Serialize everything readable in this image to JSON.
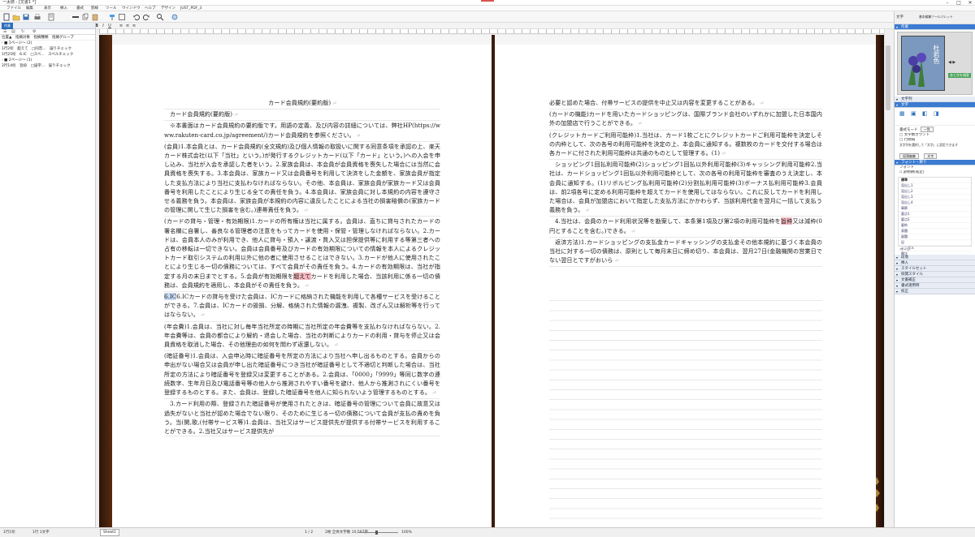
{
  "window": {
    "title": "一太郎 - [文書1 *]",
    "min": "–",
    "max": "□",
    "close": "✕"
  },
  "menu": [
    "ファイル",
    "編集",
    "表示",
    "挿入",
    "書式",
    "罫線",
    "ツール",
    "ウインドウ",
    "ヘルプ",
    "デザイン",
    "JUST_PDF_3"
  ],
  "toolbar": {
    "font_name": "(和欧混在)",
    "font_size": "10.5",
    "right_label": "文字"
  },
  "left_panel": {
    "tab_label": "作業",
    "columns": "位置▲　指摘対象　指摘種類　指摘グループ",
    "rows": [
      "- ■ 1ページ～ (2)",
      "1行2桁　超えて　□同音...　誤りチェック",
      "1行25桁　6.IC　□スペ...　スペルチェック",
      "- ■ 2ページ～ (1)",
      "2行14桁　旨枠　□誤字...　誤りチェック"
    ]
  },
  "doc": {
    "left_page": {
      "title": "カード会員規約(要約版)",
      "subtitle": "カード会員規約(要約版)",
      "paras": [
        "※本書面はカード会員規約の要約版です。用語の定義、及び内容の詳細については、弊社HP(https://www.rakuten-card.co.jp/agreement/)カード会員規約を参照ください。",
        "(会員)1.本会員とは、カード会員規約(全文規約)及び個人情報の取扱いに関する同意条項を承認の上、楽天カード株式会社(以下「当社」という。)が発行するクレジットカード(以下「カード」という。)への入会を申し込み、当社が入会を承認した者をいう。2.家族会員は、本会員が会員資格を喪失した場合には当然に会員資格を喪失する。3.本会員は、家族カード又は会員番号を利用して決済をした金額を、家族会員が指定した支払方法により当社に支払わなければならない。その他、本会員は、家族会員が家族カード又は会員番号を利用したことにより生じる全ての責任を負う。4.本会員は、家族会員に対し本規約の内容を遵守させる義務を負う。本会員は、家族会員が本規約の内容に違反したことによる当社の損害賠償の(家族カードの管理に関して生じた損害を含む。)連帯責任を負う。",
        "(カードの貸与・管理・有効期限)1.カードの所有権は当社に属する。会員は、直ちに貸与されたカードの署名欄に自署し、善良なる管理者の注意をもってカードを使用・保管・管理しなければならない。2.カードは、会員本人のみが利用でき、他人に貸与・預入・譲渡・質入又は担保提供等に利用する等第三者への占有の移転は一切できない。会員は会員番号及びカードの有効期限についての情報を本人によるクレジットカード取引システムの利用以外に他の者に使用させることはできない。3.カードが他人に使用されたことにより生じる一切の債務については、すべて会員がその責任を負う。4.カードの有効期限は、当社が指定する月の末日までとする。5.会員が有効期限を",
        "6.ICカードの貸与を受けた会員は、ICカードに格納された機能を利用して各種サービスを受けることができる。7.会員は、ICカードの毀損、分解、格納された情報の漏洩、複製、改ざん又は解析等を行ってはならない。",
        "(年会費)1.会員は、当社に対し毎年当社所定の時期に当社所定の年会費等を支払わなければならない。2.年会費等は、会員の都合により解約・退会した場合、当社の判断によりカードの利用・貸与を停止又は会員資格を取消した場合、その他理由の如何を問わず返還しない。",
        "(暗証番号)1.会員は、入会申込時に暗証番号を所定の方法により当社へ申し出るものとする。会員からの申出がない場合又は会員が申し出た暗証番号につき当社が暗証番号として不適切と判断した場合は、当社所定の方法により暗証番号を登録又は変更することがある。2.会員は、「0000」「9999」等同じ数字の連続数字、生年月日及び電話番号等の他人から推測されやすい番号を避け、他人から推測されにくい番号を登録するものとする。また、会員は、登録した暗証番号を他人に知られないよう管理するものとする。",
        "3.カード利用の際、登録された暗証番号が使用されたときは、暗証番号の管理について会員に故意又は過失がないと当社が認めた場合でない限り、そのために生じる一切の債務について会員が支払の責めを負う。当(関,歌,(付帯サービス等)1.会員は、当社又はサービス提供先が提供する付帯サービスを利用することができる。2.当社又はサービス提供先が"
      ],
      "hl_before": "5.会員が有効期限を",
      "hl_red": "超えて",
      "hl_after": "カードを利用した場合、当該利用に係る一切の債務は、会員規約を適用し、本会員がその責任を負う。",
      "hl_blue": "6.IC"
    },
    "right_page": {
      "paras": [
        "必要と認めた場合、付帯サービスの提供を中止又は内容を変更することがある。",
        "(カードの機能)カードを用いたカードショッピングは、国際ブランド会社のいずれかに加盟した日本国内外の加盟店で行うことができる。",
        "(クレジットカードご利用可能枠)1.当社は、カード1枚ごとにクレジットカードご利用可能枠を決定しその内枠として、次の各号の利用可能枠を決定の上、本会員に通知する。複数枚のカードを交付する場合は各カードに付された利用可能枠は共通のものとして管理する。(1)",
        "ショッピング1回払利用可能枠(2)ショッピング1回払以外利用可能枠(3)キャッシング利用可能枠2.当社は、カードショッピング1回払以外利用可能枠として、次の各号の利用可能枠を審査のうえ決定し、本会員に通知する。(1)リボルビング払利用可能枠(2)分割払利用可能枠(3)ボーナス払利用可能枠3.会員は、前2項各号に定める利用可能枠を超えてカードを使用してはならない。これに反してカードを利用した場合は、会員が加盟店において指定した支払方法にかかわらず、当該利用代金を翌月に一括して支払う義務を負う。",
        "4.当社は、会員のカード利用状況等を勘案して、本条第1項及び第2項の利用可能枠を",
        "返済方法)1.カードショッピングの支払金カードキャッシングの支払金その他本規約に基づく本会員の当社に対する一切の債務は、原則として毎月末日に締め切り、本会員は、翌月27日(金融機関の営業日でない翌日とですがおいら"
      ],
      "hl_red": "旨枠",
      "hl_after": "又は減枠(0円とすることを含む。)できる。"
    }
  },
  "right_panel": {
    "top_label": "文字",
    "subtitle": "基本編集ツールパレット",
    "sections": [
      "作業",
      "文字列",
      "文字",
      "フォント・飾り",
      "段落",
      "挿入",
      "スタイルセット",
      "校閲スタイル",
      "文書補正",
      "書式適用時",
      "校正"
    ],
    "template_text": "杜若色",
    "nav_label": "あと次を検索",
    "doc_mode_label": "書式モード",
    "doc_mode_value": "一覧",
    "check1": "文字数カウント",
    "check2": "行間隔",
    "note": "文字列を選択して「文字」に設定できます",
    "btn1": "段落編集",
    "btn2": "文字",
    "font_label": "フォント",
    "font_value": "游明朝(既定)",
    "style_header": "標準",
    "styles": [
      "見出し1",
      "見出し2",
      "見出し3",
      "見出し4",
      "章節",
      "要点1",
      "要点2",
      "要約",
      "表題",
      "副題",
      "記",
      "シンボル",
      "脚注",
      "番号"
    ],
    "footer_btn": "ページ"
  },
  "status": {
    "sheet_tab": "Sheet1",
    "cursor": "1行1桁",
    "count": "1行 1文字",
    "page": "1 / 2",
    "zoom": "100%",
    "pages_label": "2枚 全体文字数 10,587字"
  }
}
